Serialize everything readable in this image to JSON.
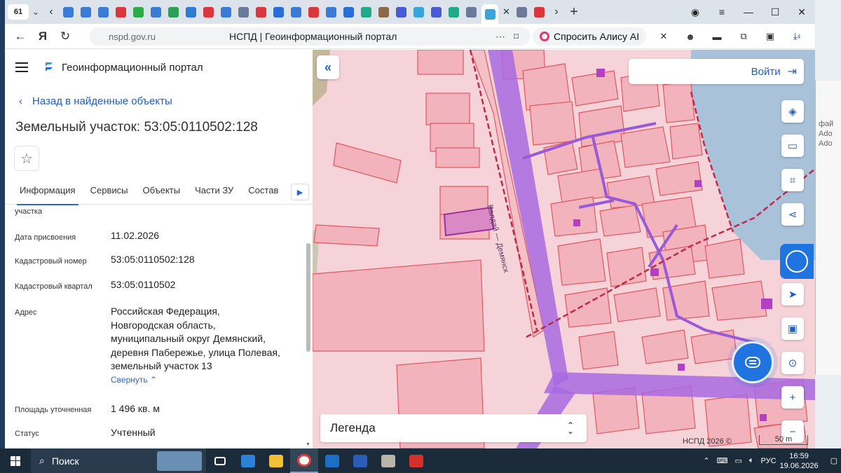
{
  "browser": {
    "tab_count": "61",
    "url_domain": "nspd.gov.ru",
    "page_title": "НСПД | Геоинформационный портал",
    "alice_button": "Спросить Алису AI",
    "ext_badge": "4",
    "favicon_colors": [
      "#3a7bd5",
      "#3a7bd5",
      "#3a7bd5",
      "#d9363e",
      "#2eaa4a",
      "#3a7bd5",
      "#2e9e5b",
      "#2e7bd5",
      "#d9363e",
      "#3a7bd5",
      "#6b7a99",
      "#d9363e",
      "#2a6dd6",
      "#3a7bd5",
      "#d9363e",
      "#3a7bd5",
      "#2a6dd6",
      "#22aa88",
      "#8a6a4a",
      "#4b5bd6",
      "#3aa6d8",
      "#4b5bd6",
      "#22aa88",
      "#6b7a99"
    ]
  },
  "panel": {
    "app_title": "Геоинформационный портал",
    "back_link": "Назад в найденные объекты",
    "title": "Земельный участок: 53:05:0110502:128",
    "tabs": [
      "Информация",
      "Сервисы",
      "Объекты",
      "Части ЗУ",
      "Состав"
    ],
    "rows": {
      "partial_key": "участка",
      "date_key": "Дата присвоения",
      "date_val": "11.02.2026",
      "cad_key": "Кадастровый номер",
      "cad_val": "53:05:0110502:128",
      "quarter_key": "Кадастровый квартал",
      "quarter_val": "53:05:0110502",
      "addr_key": "Адрес",
      "addr_lines": [
        "Российская Федерация,",
        "Новгородская область,",
        "муниципальный округ Демянский,",
        "деревня Паберeжье, улица Полевая,",
        "земельный участок 13"
      ],
      "collapse_link": "Свернуть",
      "area_key": "Площадь уточненная",
      "area_val": "1 496 кв. м",
      "status_key": "Статус",
      "status_val": "Учтенный"
    }
  },
  "map": {
    "login": "Войти",
    "legend": "Легенда",
    "copyright": "НСПД 2026 ©",
    "scale": "50 m",
    "road_label": "Валдай — Демянск",
    "parcel_fill": "#f2b3bd",
    "parcel_stroke": "#e0585f",
    "road_color": "#a86ae0",
    "water_color": "#a9c1d9",
    "accent": "#1f74e0"
  },
  "side_peek": [
    "фай",
    "Ado",
    "Ado"
  ],
  "taskbar": {
    "search_label": "Поиск",
    "lang": "РУС",
    "time": "16:59",
    "date": "19.06.2026"
  }
}
